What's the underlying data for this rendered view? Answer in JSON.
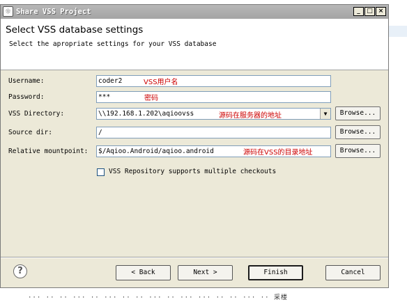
{
  "window": {
    "title": "Share VSS Project",
    "minimize_glyph": "_",
    "maximize_glyph": "□",
    "close_glyph": "×",
    "icon": "eclipse-icon",
    "icon_glyph": "☼"
  },
  "header": {
    "title": "Select VSS database settings",
    "subtitle": "Select the apropriate settings for your VSS database"
  },
  "form": {
    "username": {
      "label": "Username:",
      "value": "coder2",
      "note": "VSS用户名"
    },
    "password": {
      "label": "Password:",
      "value": "***",
      "note": "密码"
    },
    "vss_directory": {
      "label": "VSS Directory:",
      "value": "\\\\192.168.1.202\\aqioovss",
      "note": "源码在服务器的地址",
      "arrow_glyph": "▼"
    },
    "source_dir": {
      "label": "Source dir:",
      "value": "/"
    },
    "relative_mountpoint": {
      "label": "Relative mountpoint:",
      "value": "$/Aqioo.Android/aqioo.android",
      "note": "源码在VSS的目录地址"
    },
    "browse_label": "Browse...",
    "multiple_checkouts": {
      "label": "VSS Repository supports multiple checkouts",
      "checked": false
    }
  },
  "buttons": {
    "help": "?",
    "back": "< Back",
    "next": "Next >",
    "finish": "Finish",
    "cancel": "Cancel"
  },
  "footer": {
    "text": "··· ·· ·· ··· ·· ··· ·· ·· ··· ·· ··· ··· ·· ·· ··· ·· 采楼"
  },
  "colors": {
    "note_red": "#cc0000",
    "titlebar": "#a9a9a9",
    "dialog_bg": "#ece9d8"
  }
}
